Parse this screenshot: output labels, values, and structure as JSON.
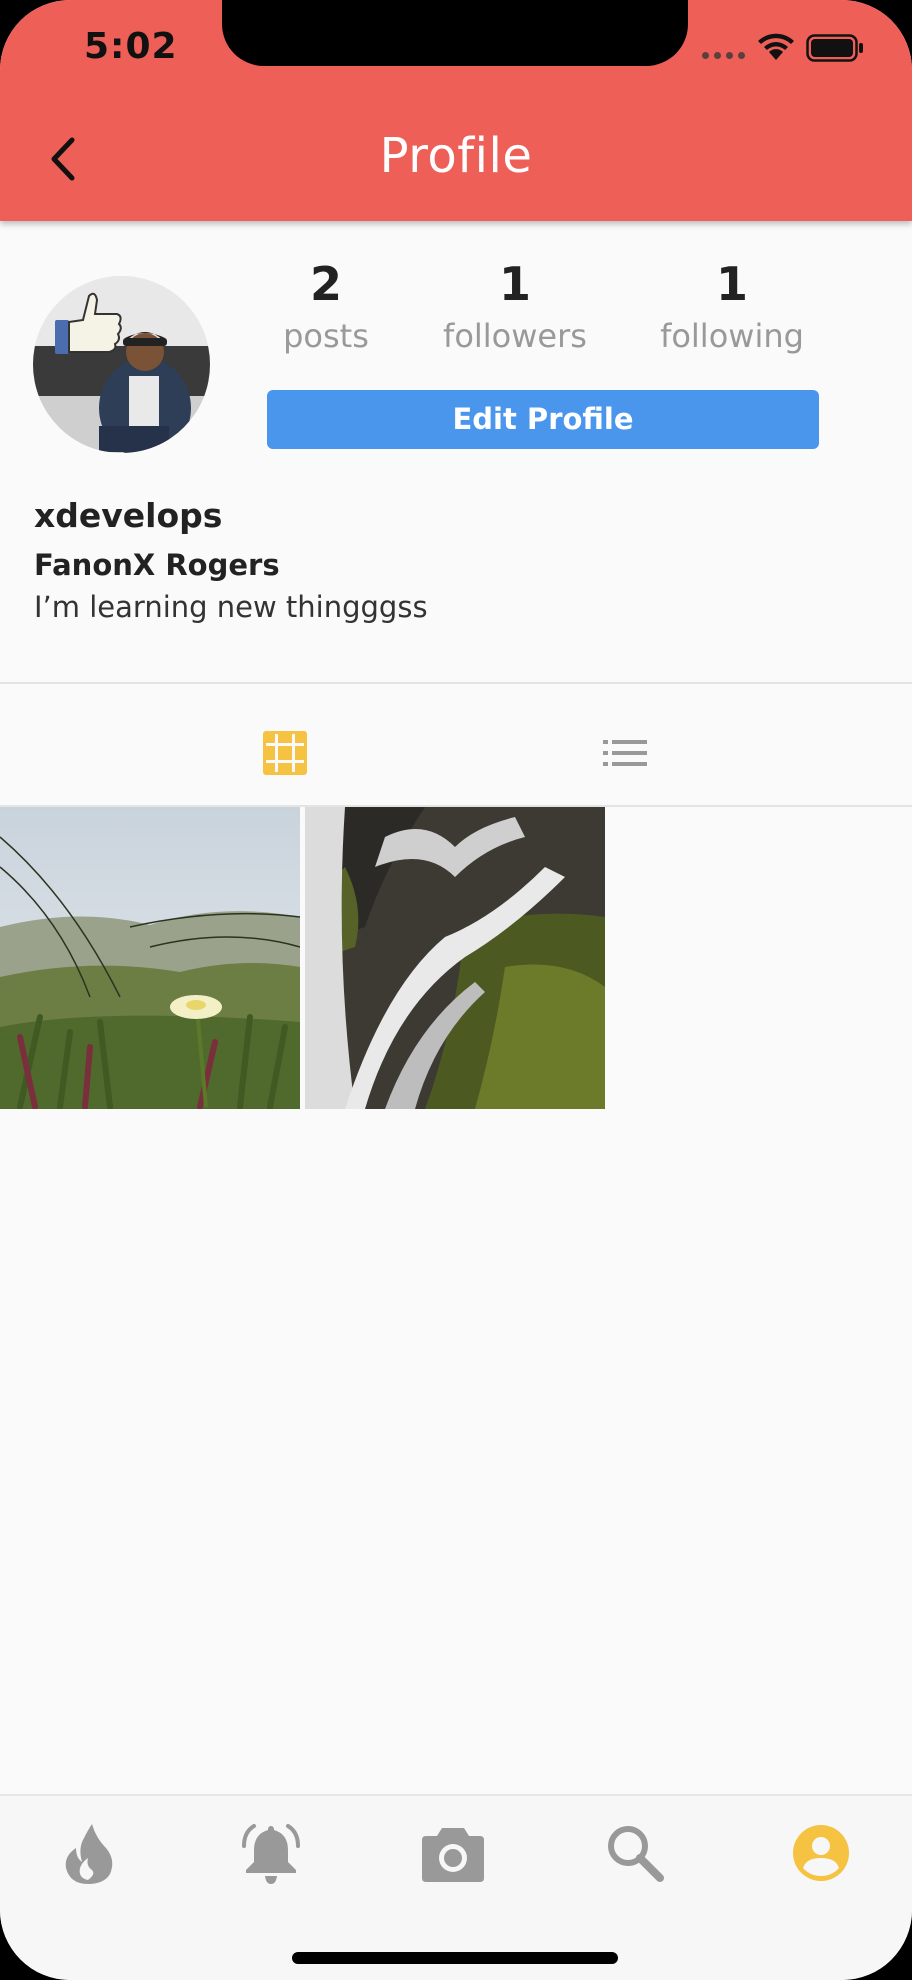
{
  "status_bar": {
    "time": "5:02"
  },
  "header": {
    "title": "Profile"
  },
  "profile": {
    "stats": [
      {
        "value": "2",
        "label": "posts"
      },
      {
        "value": "1",
        "label": "followers"
      },
      {
        "value": "1",
        "label": "following"
      }
    ],
    "edit_button": "Edit Profile",
    "username": "xdevelops",
    "display_name": "FanonX Rogers",
    "bio": "I’m learning new thingggss"
  },
  "tabs": {
    "active": "grid-icon",
    "items": [
      "grid-icon",
      "list-icon"
    ]
  },
  "colors": {
    "header": "#ee5f58",
    "accent": "#f5c242",
    "button": "#4a96ec",
    "nav_inactive": "#999999"
  },
  "bottom_nav": {
    "active": "profile-icon",
    "items": [
      "fire-icon",
      "bell-icon",
      "camera-icon",
      "search-icon",
      "profile-icon"
    ]
  }
}
